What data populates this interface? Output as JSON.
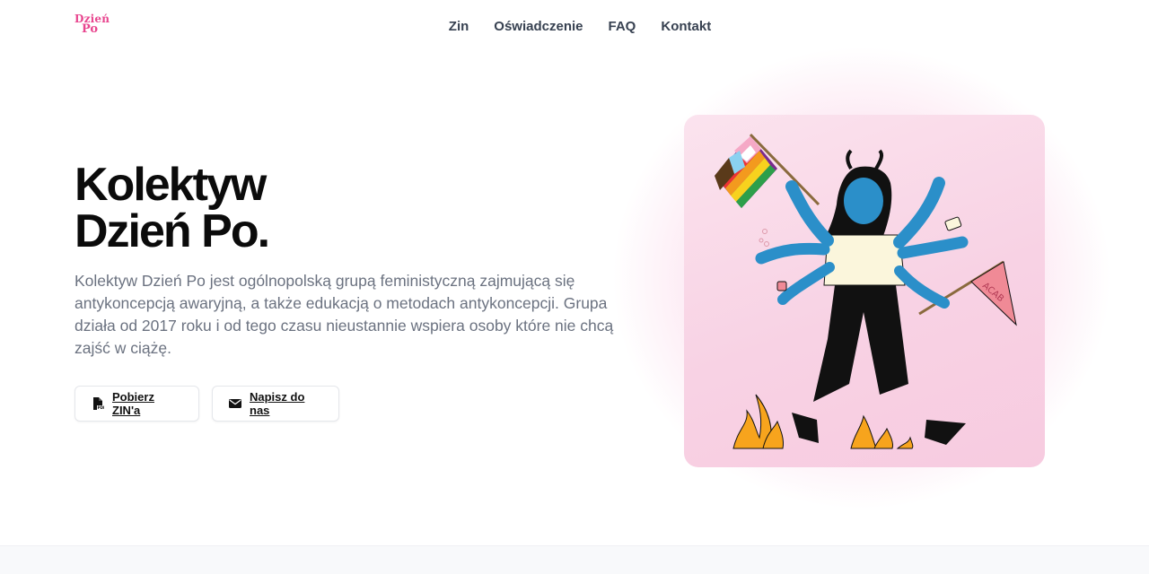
{
  "logo": {
    "line1": "Dzień",
    "line2": "Po"
  },
  "nav": {
    "items": [
      {
        "label": "Zin"
      },
      {
        "label": "Oświadczenie"
      },
      {
        "label": "FAQ"
      },
      {
        "label": "Kontakt"
      }
    ]
  },
  "hero": {
    "title_line1": "Kolektyw",
    "title_line2": "Dzień Po.",
    "description": "Kolektyw Dzień Po jest ogólnopolską grupą feministyczną zajmującą się antykoncepcją awaryjną, a także edukacją o metodach antykoncepcji. Grupa działa od 2017 roku i od tego czasu nieustannie wspiera osoby które nie chcą zajść w ciążę.",
    "buttons": {
      "download_label": "Pobierz ZIN'a",
      "download_icon": "pdf-file-icon",
      "contact_label": "Napisz do nas",
      "contact_icon": "envelope-icon"
    }
  },
  "illustration": {
    "pennant_text": "ACAB",
    "colors": {
      "accent_pink": "#e8468f",
      "skin_blue": "#2b8fc9",
      "shirt": "#fbf6dc",
      "pants": "#111111",
      "flame": "#f7a41d"
    }
  }
}
